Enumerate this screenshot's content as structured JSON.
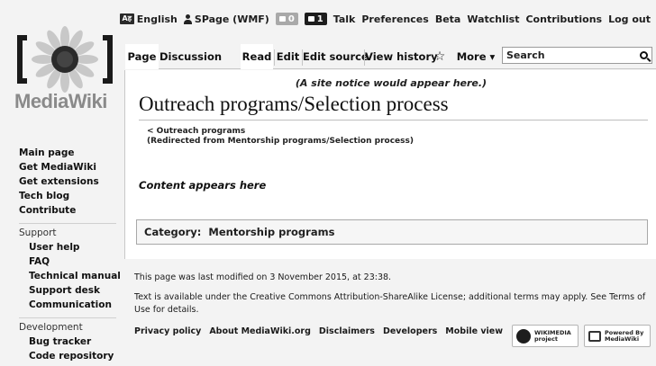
{
  "personal": {
    "language": "English",
    "language_glyph": "Aह",
    "username": "SPage (WMF)",
    "alerts_count": "0",
    "notices_count": "1",
    "talk": "Talk",
    "preferences": "Preferences",
    "beta": "Beta",
    "watchlist": "Watchlist",
    "contributions": "Contributions",
    "logout": "Log out"
  },
  "logo": {
    "name": "MediaWiki"
  },
  "tabs": {
    "page": "Page",
    "discussion": "Discussion",
    "read": "Read",
    "edit": "Edit",
    "edit_source": "Edit source",
    "view_history": "View history",
    "watch_glyph": "☆",
    "more": "More ▾"
  },
  "search": {
    "placeholder": "Search"
  },
  "content": {
    "site_notice": "(A site notice would appear here.)",
    "title": "Outreach programs/Selection process",
    "subpage_link": "< Outreach programs",
    "redirect_note": "(Redirected from Mentorship programs/Selection process)",
    "body": "Content appears here",
    "category_label": "Category:",
    "category_value": "Mentorship programs"
  },
  "sidebar": {
    "main": [
      "Main page",
      "Get MediaWiki",
      "Get extensions",
      "Tech blog",
      "Contribute"
    ],
    "support_heading": "Support",
    "support": [
      "User help",
      "FAQ",
      "Technical manual",
      "Support desk",
      "Communication"
    ],
    "development_heading": "Development",
    "development": [
      "Bug tracker",
      "Code repository"
    ]
  },
  "footer": {
    "last_modified": "This page was last modified on 3 November 2015, at 23:38.",
    "license_line1": "Text is available under the Creative Commons Attribution-ShareAlike License; additional terms may apply. See Terms of",
    "license_line2": "Use for details.",
    "links": [
      "Privacy policy",
      "About MediaWiki.org",
      "Disclaimers",
      "Developers",
      "Mobile view"
    ],
    "wikimedia_badge": "WIKIMEDIA",
    "wikimedia_sub": "project",
    "powered_badge": "Powered By",
    "powered_name": "MediaWiki"
  }
}
